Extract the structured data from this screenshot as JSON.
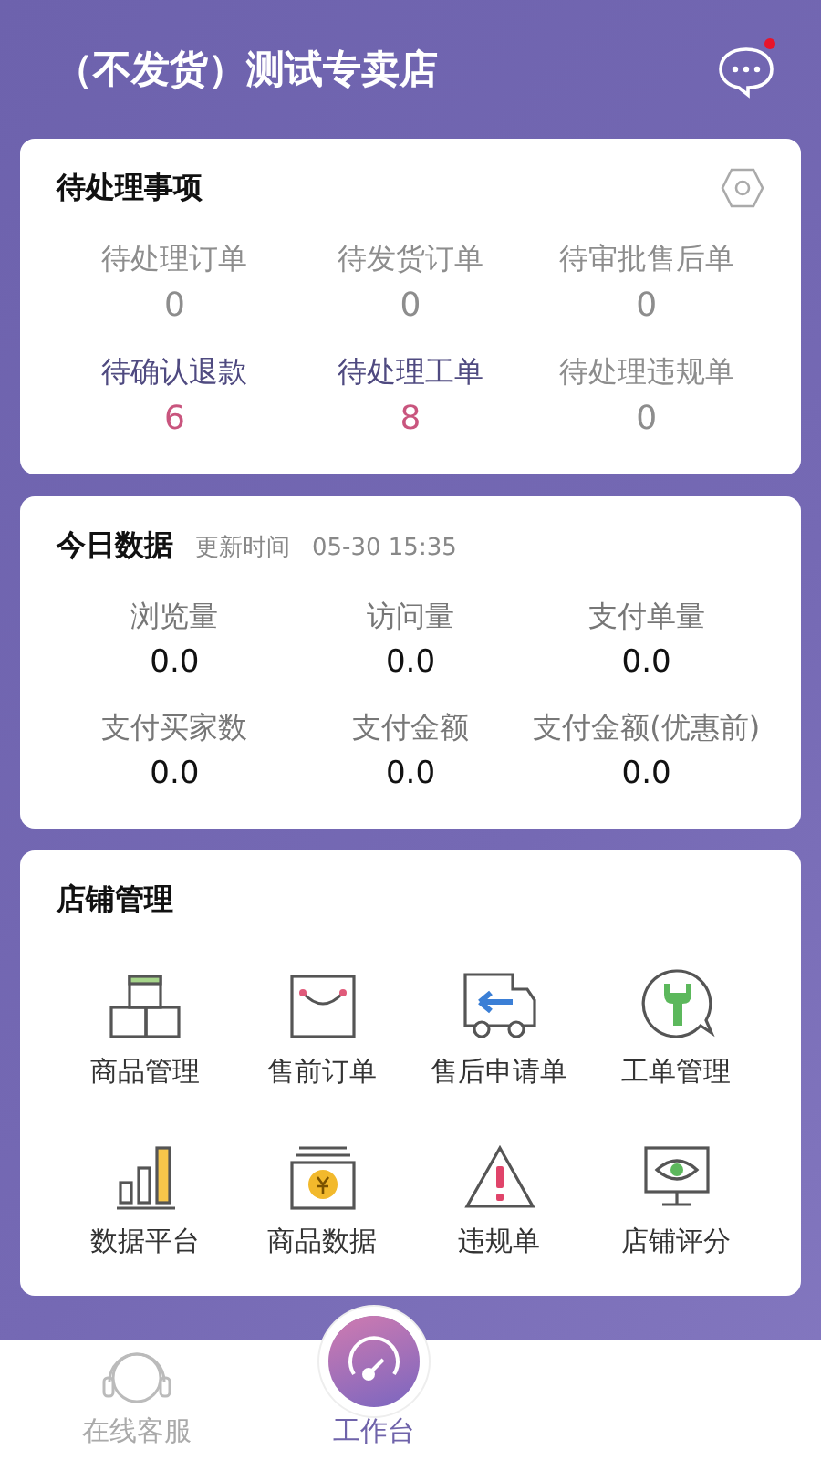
{
  "header": {
    "title": "（不发货）测试专卖店",
    "has_unread": true
  },
  "pending": {
    "title": "待处理事项",
    "items": [
      {
        "label": "待处理订单",
        "count": "0",
        "highlight": false
      },
      {
        "label": "待发货订单",
        "count": "0",
        "highlight": false
      },
      {
        "label": "待审批售后单",
        "count": "0",
        "highlight": false
      },
      {
        "label": "待确认退款",
        "count": "6",
        "highlight": true
      },
      {
        "label": "待处理工单",
        "count": "8",
        "highlight": true
      },
      {
        "label": "待处理违规单",
        "count": "0",
        "highlight": false
      }
    ]
  },
  "today": {
    "title": "今日数据",
    "updated_label": "更新时间",
    "updated_time": "05-30 15:35",
    "items": [
      {
        "label": "浏览量",
        "value": "0.0"
      },
      {
        "label": "访问量",
        "value": "0.0"
      },
      {
        "label": "支付单量",
        "value": "0.0"
      },
      {
        "label": "支付买家数",
        "value": "0.0"
      },
      {
        "label": "支付金额",
        "value": "0.0"
      },
      {
        "label": "支付金额(优惠前)",
        "value": "0.0"
      }
    ]
  },
  "management": {
    "title": "店铺管理",
    "items": [
      {
        "label": "商品管理",
        "kind": "boxes"
      },
      {
        "label": "售前订单",
        "kind": "bag"
      },
      {
        "label": "售后申请单",
        "kind": "truck"
      },
      {
        "label": "工单管理",
        "kind": "wrench"
      },
      {
        "label": "数据平台",
        "kind": "bars"
      },
      {
        "label": "商品数据",
        "kind": "money"
      },
      {
        "label": "违规单",
        "kind": "warning"
      },
      {
        "label": "店铺评分",
        "kind": "monitor"
      }
    ]
  },
  "tabs": [
    {
      "label": "在线客服",
      "kind": "headset",
      "selected": false
    },
    {
      "label": "工作台",
      "kind": "gauge",
      "selected": true
    }
  ]
}
